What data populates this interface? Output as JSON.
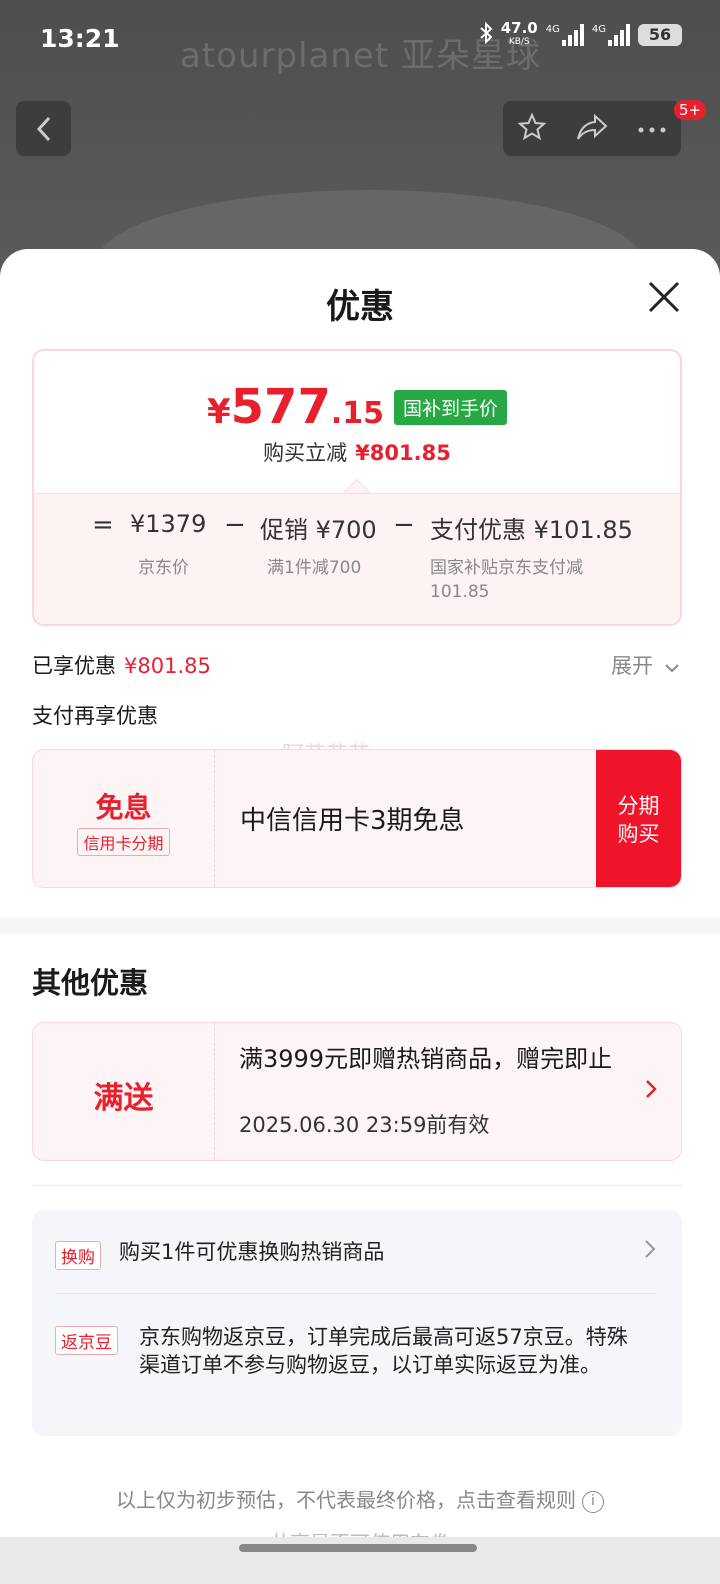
{
  "status_bar": {
    "time": "13:21",
    "net_speed": "47.0",
    "net_unit": "KB/S",
    "net_type_1": "4G",
    "net_type_2": "4G",
    "battery": "56"
  },
  "background": {
    "brand_text": "atourplanet 亚朵星球",
    "badge_count": "5+"
  },
  "sheet": {
    "title": "优惠"
  },
  "price_card": {
    "currency": "¥",
    "price_int": "577",
    "price_dec": ".15",
    "price_tag": "国补到手价",
    "cut_label": "购买立减",
    "cut_amount": "¥801.85",
    "eq_sign": "=",
    "jd_price": "¥1379",
    "jd_price_label": "京东价",
    "minus": "−",
    "promo": "促销 ¥700",
    "promo_desc": "满1件减700",
    "pay_discount": "支付优惠 ¥101.85",
    "pay_discount_desc": "国家补贴京东支付减101.85"
  },
  "enjoyed": {
    "label": "已享优惠",
    "amount": "¥801.85",
    "expand": "展开"
  },
  "pay_more": {
    "label": "支付再享优惠",
    "watermark": "阿花花花"
  },
  "installment_coupon": {
    "title": "免息",
    "tag": "信用卡分期",
    "text": "中信信用卡3期免息",
    "button_line1": "分期",
    "button_line2": "购买"
  },
  "other": {
    "title": "其他优惠"
  },
  "gift_coupon": {
    "title": "满送",
    "text": "满3999元即赠热销商品，赠完即止",
    "date": "2025.06.30 23:59前有效"
  },
  "info": {
    "exchange_tag": "换购",
    "exchange_text": "购买1件可优惠换购热销商品",
    "bean_tag": "返京豆",
    "bean_text": "京东购物返京豆，订单完成后最高可返57京豆。特殊渠道订单不参与购物返豆，以订单实际返豆为准。"
  },
  "footer": {
    "disclaimer": "以上仅为初步预估，不代表最终价格，点击查看规则",
    "info_icon": "i",
    "cut_text": "共享是否可使用东券"
  }
}
